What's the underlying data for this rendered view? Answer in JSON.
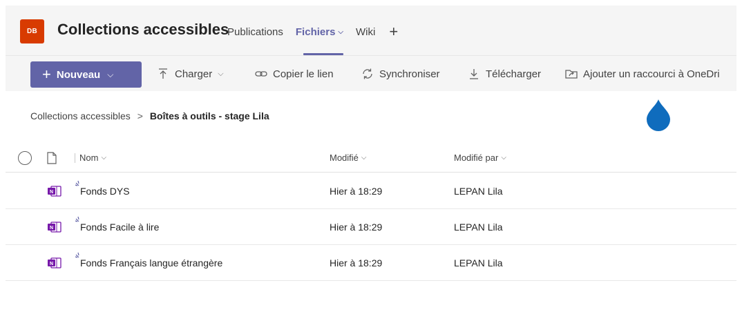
{
  "header": {
    "team_initials": "DB",
    "team_name": "Collections accessibles",
    "tabs": [
      {
        "label": "Publications"
      },
      {
        "label": "Fichiers"
      },
      {
        "label": "Wiki"
      }
    ],
    "add_tab": "+"
  },
  "toolbar": {
    "new_label": "Nouveau",
    "upload_label": "Charger",
    "copy_link_label": "Copier le lien",
    "sync_label": "Synchroniser",
    "download_label": "Télécharger",
    "shortcut_label": "Ajouter un raccourci à OneDri"
  },
  "breadcrumb": {
    "root": "Collections accessibles",
    "separator": ">",
    "current": "Boîtes à outils - stage Lila"
  },
  "list": {
    "columns": {
      "name": "Nom",
      "modified": "Modifié",
      "modified_by": "Modifié par"
    },
    "rows": [
      {
        "name": "Fonds DYS",
        "modified": "Hier à 18:29",
        "modified_by": "LEPAN Lila"
      },
      {
        "name": "Fonds Facile à lire",
        "modified": "Hier à 18:29",
        "modified_by": "LEPAN Lila"
      },
      {
        "name": "Fonds Français langue étrangère",
        "modified": "Hier à 18:29",
        "modified_by": "LEPAN Lila"
      }
    ]
  },
  "colors": {
    "accent": "#6264a7",
    "team_avatar": "#d83b01",
    "onenote": "#7719aa",
    "drop_marker": "#0f6cbd"
  }
}
